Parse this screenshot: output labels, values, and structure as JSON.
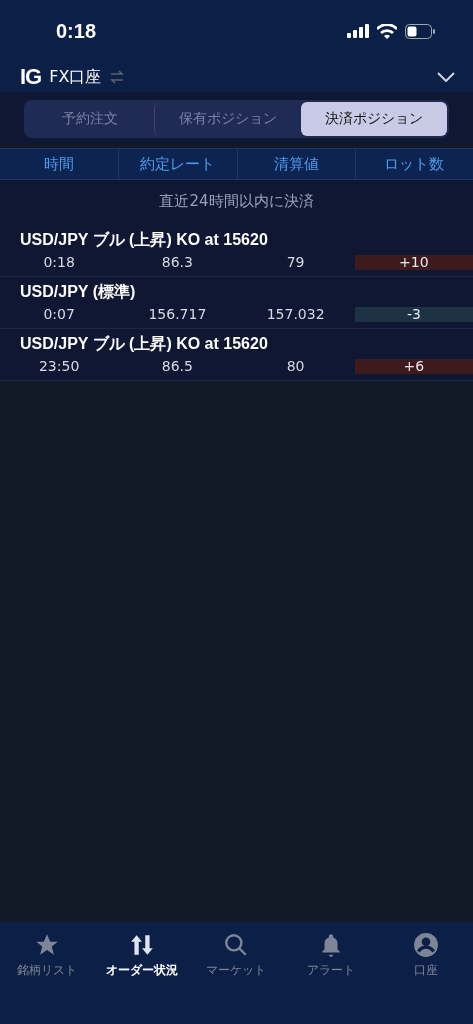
{
  "status_bar": {
    "time": "0:18"
  },
  "header": {
    "logo": "IG",
    "account": "FX口座"
  },
  "tabs": [
    {
      "label": "予約注文",
      "selected": false
    },
    {
      "label": "保有ポジション",
      "selected": false
    },
    {
      "label": "決済ポジション",
      "selected": true
    }
  ],
  "table": {
    "columns": [
      "時間",
      "約定レート",
      "清算値",
      "ロット数"
    ],
    "caption": "直近24時間以内に決済",
    "rows": [
      {
        "title": "USD/JPY ブル (上昇) KO at 15620",
        "time": "0:18",
        "rate": "86.3",
        "settle": "79",
        "lots": "+10",
        "color": "#3e1a1c"
      },
      {
        "title": "USD/JPY (標準)",
        "time": "0:07",
        "rate": "156.717",
        "settle": "157.032",
        "lots": "-3",
        "color": "#1d3242"
      },
      {
        "title": "USD/JPY ブル (上昇) KO at 15620",
        "time": "23:50",
        "rate": "86.5",
        "settle": "80",
        "lots": "+6",
        "color": "#3e1a1c"
      }
    ]
  },
  "bottom_nav": [
    {
      "kind": "star",
      "label": "銘柄リスト",
      "selected": false
    },
    {
      "kind": "order",
      "label": "オーダー状況",
      "selected": true
    },
    {
      "kind": "search",
      "label": "マーケット",
      "selected": false
    },
    {
      "kind": "bell",
      "label": "アラート",
      "selected": false
    },
    {
      "kind": "account",
      "label": "口座",
      "selected": false
    }
  ]
}
